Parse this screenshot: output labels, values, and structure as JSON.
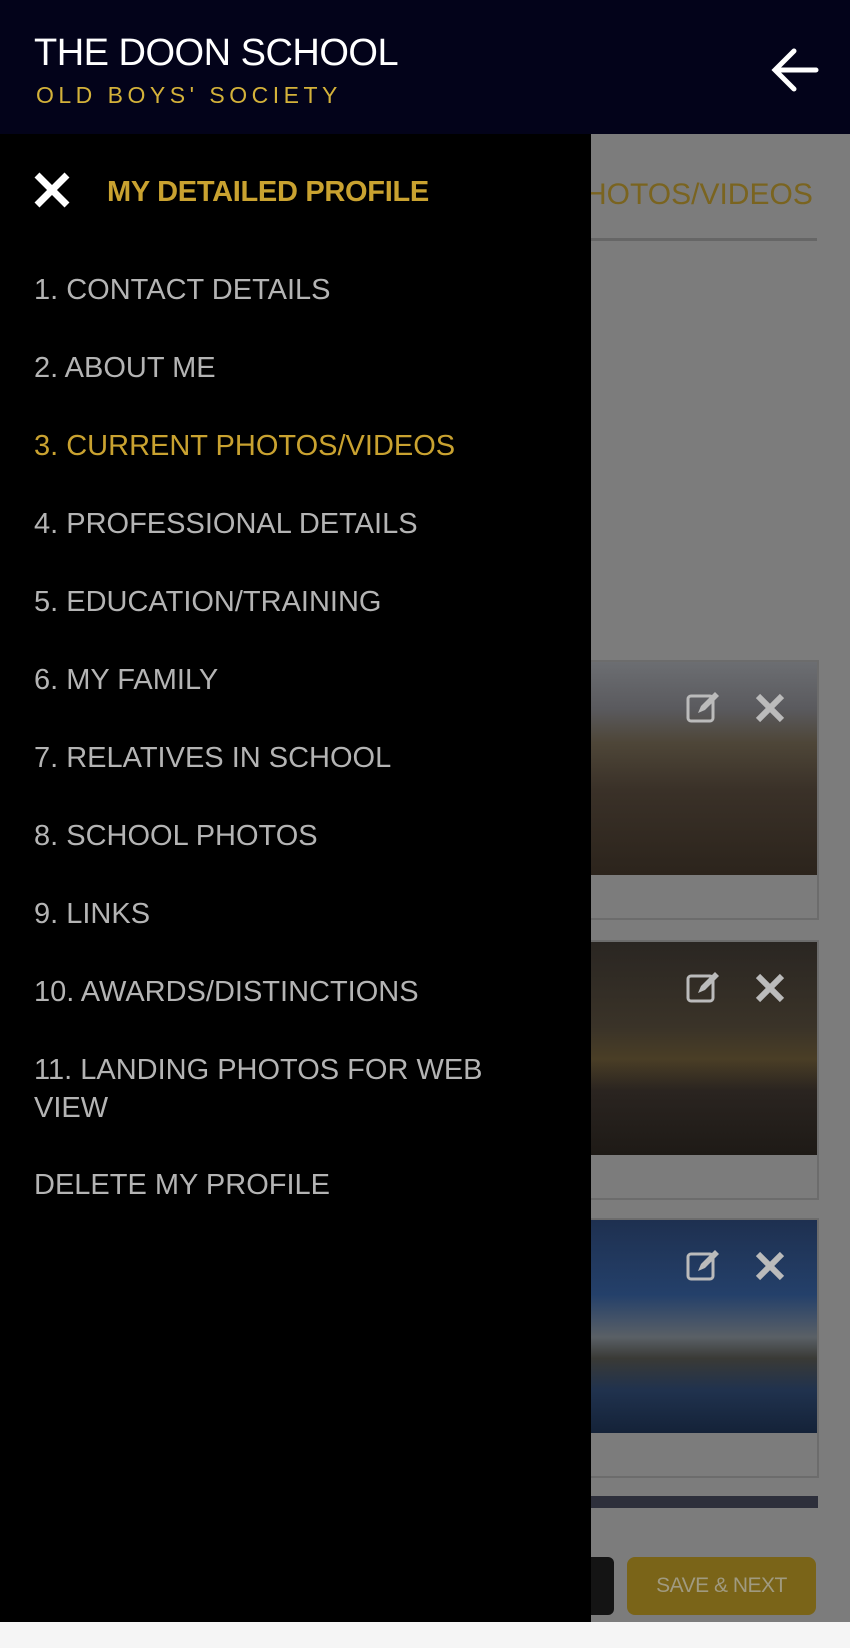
{
  "header": {
    "title": "THE DOON SCHOOL",
    "subtitle": "OLD BOYS' SOCIETY",
    "back_icon": "arrow-left-icon"
  },
  "background": {
    "tab_label": "HOTOS/VIDEOS",
    "photos": [
      {
        "edit_icon": "edit-icon",
        "delete_icon": "close-icon"
      },
      {
        "edit_icon": "edit-icon",
        "delete_icon": "close-icon"
      },
      {
        "edit_icon": "edit-icon",
        "delete_icon": "close-icon"
      }
    ],
    "save_button": "SAVE & NEXT"
  },
  "drawer": {
    "close_icon": "close-icon",
    "title": "MY DETAILED PROFILE",
    "active_index": 2,
    "items": [
      {
        "label": "1. CONTACT DETAILS"
      },
      {
        "label": "2. ABOUT ME"
      },
      {
        "label": "3. CURRENT PHOTOS/VIDEOS"
      },
      {
        "label": "4. PROFESSIONAL DETAILS"
      },
      {
        "label": "5. EDUCATION/TRAINING"
      },
      {
        "label": "6. MY FAMILY"
      },
      {
        "label": "7. RELATIVES IN SCHOOL"
      },
      {
        "label": "8. SCHOOL PHOTOS"
      },
      {
        "label": "9. LINKS"
      },
      {
        "label": "10. AWARDS/DISTINCTIONS"
      },
      {
        "label": "11. LANDING PHOTOS FOR WEB VIEW"
      },
      {
        "label": "DELETE MY PROFILE"
      }
    ]
  },
  "colors": {
    "header_bg": "#03031a",
    "accent_gold": "#c9a230",
    "drawer_bg": "#000000"
  }
}
